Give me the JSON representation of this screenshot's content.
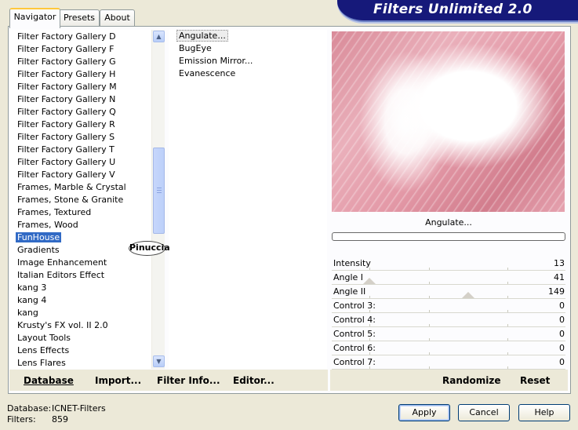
{
  "window": {
    "banner_title": "Filters Unlimited 2.0"
  },
  "tabs": [
    {
      "label": "Navigator"
    },
    {
      "label": "Presets"
    },
    {
      "label": "About"
    }
  ],
  "categories": {
    "items": [
      "Filter Factory Gallery D",
      "Filter Factory Gallery F",
      "Filter Factory Gallery G",
      "Filter Factory Gallery H",
      "Filter Factory Gallery M",
      "Filter Factory Gallery N",
      "Filter Factory Gallery Q",
      "Filter Factory Gallery R",
      "Filter Factory Gallery S",
      "Filter Factory Gallery T",
      "Filter Factory Gallery U",
      "Filter Factory Gallery V",
      "Frames, Marble & Crystal",
      "Frames, Stone & Granite",
      "Frames, Textured",
      "Frames, Wood",
      "FunHouse",
      "Gradients",
      "Image Enhancement",
      "Italian Editors Effect",
      "kang 3",
      "kang 4",
      "kang",
      "Krusty's FX vol. II 2.0",
      "Layout Tools",
      "Lens Effects",
      "Lens Flares"
    ],
    "selected": "FunHouse"
  },
  "watermark": {
    "text": "Pinuccia"
  },
  "filters": {
    "items": [
      "Angulate...",
      "BugEye",
      "Emission Mirror...",
      "Evanescence"
    ],
    "selected": "Angulate..."
  },
  "preview": {
    "filter_name": "Angulate...",
    "progress": 0
  },
  "controls": [
    {
      "label": "Intensity",
      "value": "13"
    },
    {
      "label": "Angle I",
      "value": "41"
    },
    {
      "label": "Angle II",
      "value": "149"
    },
    {
      "label": "Control 3:",
      "value": "0"
    },
    {
      "label": "Control 4:",
      "value": "0"
    },
    {
      "label": "Control 5:",
      "value": "0"
    },
    {
      "label": "Control 6:",
      "value": "0"
    },
    {
      "label": "Control 7:",
      "value": "0"
    }
  ],
  "toolbar": {
    "database": "Database",
    "import": "Import...",
    "filter_info": "Filter Info...",
    "editor": "Editor...",
    "randomize": "Randomize",
    "reset": "Reset"
  },
  "status": {
    "database_label": "Database:",
    "database_value": "ICNET-Filters",
    "filters_label": "Filters:",
    "filters_value": "859"
  },
  "buttons": {
    "apply": "Apply",
    "cancel": "Cancel",
    "help": "Help"
  },
  "colors": {
    "banner": "#16197a",
    "selection": "#316ac5",
    "window_bg": "#ece9d8"
  }
}
